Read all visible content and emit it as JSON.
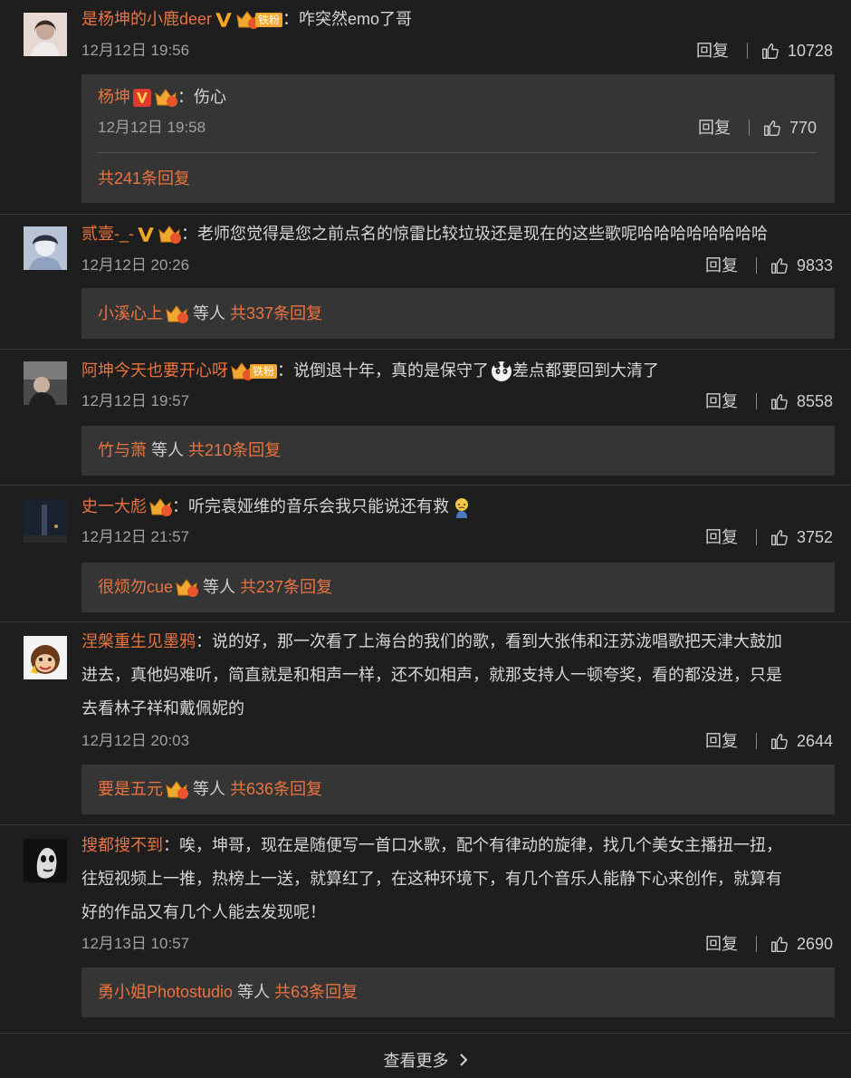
{
  "comments": [
    {
      "user": "是杨坤的小鹿deer",
      "fan_badge": "铁粉",
      "level": "2",
      "text": "咋突然emo了哥",
      "time": "12月12日 19:56",
      "reply_label": "回复",
      "likes": "10728",
      "sub": {
        "user": "杨坤",
        "level": "7",
        "text": "伤心",
        "time": "12月12日 19:58",
        "reply_label": "回复",
        "likes": "770",
        "total": "共241条回复"
      }
    },
    {
      "user": "贰壹-_-",
      "level": "6",
      "text": "老师您觉得是您之前点名的惊雷比较垃圾还是现在的这些歌呢哈哈哈哈哈哈哈哈",
      "time": "12月12日 20:26",
      "reply_label": "回复",
      "likes": "9833",
      "preview_user": "小溪心上",
      "preview_level": "1",
      "preview_etc": "等人",
      "preview_total": "共337条回复"
    },
    {
      "user": "阿坤今天也要开心呀",
      "fan_badge": "铁粉",
      "level": "5",
      "text_a": "说倒退十年，真的是保守了",
      "text_b": "差点都要回到大清了",
      "time": "12月12日 19:57",
      "reply_label": "回复",
      "likes": "8558",
      "preview_user": "竹与萧",
      "preview_etc": "等人",
      "preview_total": "共210条回复"
    },
    {
      "user": "史一大彪",
      "level": "6",
      "text": "听完袁娅维的音乐会我只能说还有救",
      "time": "12月12日 21:57",
      "reply_label": "回复",
      "likes": "3752",
      "preview_user": "很烦勿cue",
      "preview_level": "5",
      "preview_etc": "等人",
      "preview_total": "共237条回复"
    },
    {
      "user": "涅槃重生见墨鸦",
      "line1": "说的好，那一次看了上海台的我们的歌，看到大张伟和汪苏泷唱歌把天津大鼓加",
      "line2": "进去，真他妈难听，简直就是和相声一样，还不如相声，就那支持人一顿夸奖，看的都没进，只是",
      "line3": "去看林子祥和戴佩妮的",
      "time": "12月12日 20:03",
      "reply_label": "回复",
      "likes": "2644",
      "preview_user": "要是五元",
      "preview_level": "2",
      "preview_etc": "等人",
      "preview_total": "共636条回复"
    },
    {
      "user": "搜都搜不到",
      "line1": "唉，坤哥，现在是随便写一首口水歌，配个有律动的旋律，找几个美女主播扭一扭，",
      "line2": "往短视频上一推，热榜上一送，就算红了，在这种环境下，有几个音乐人能静下心来创作，就算有",
      "line3": "好的作品又有几个人能去发现呢！",
      "time": "12月13日 10:57",
      "reply_label": "回复",
      "likes": "2690",
      "preview_user": "勇小姐Photostudio",
      "preview_etc": "等人",
      "preview_total": "共63条回复"
    }
  ],
  "footer": {
    "more_label": "查看更多"
  },
  "colors": {
    "accent": "#eb7340",
    "bg": "#1e1e1e",
    "box": "#353535",
    "vip": "#f5a623",
    "crown": "#f0a830"
  }
}
